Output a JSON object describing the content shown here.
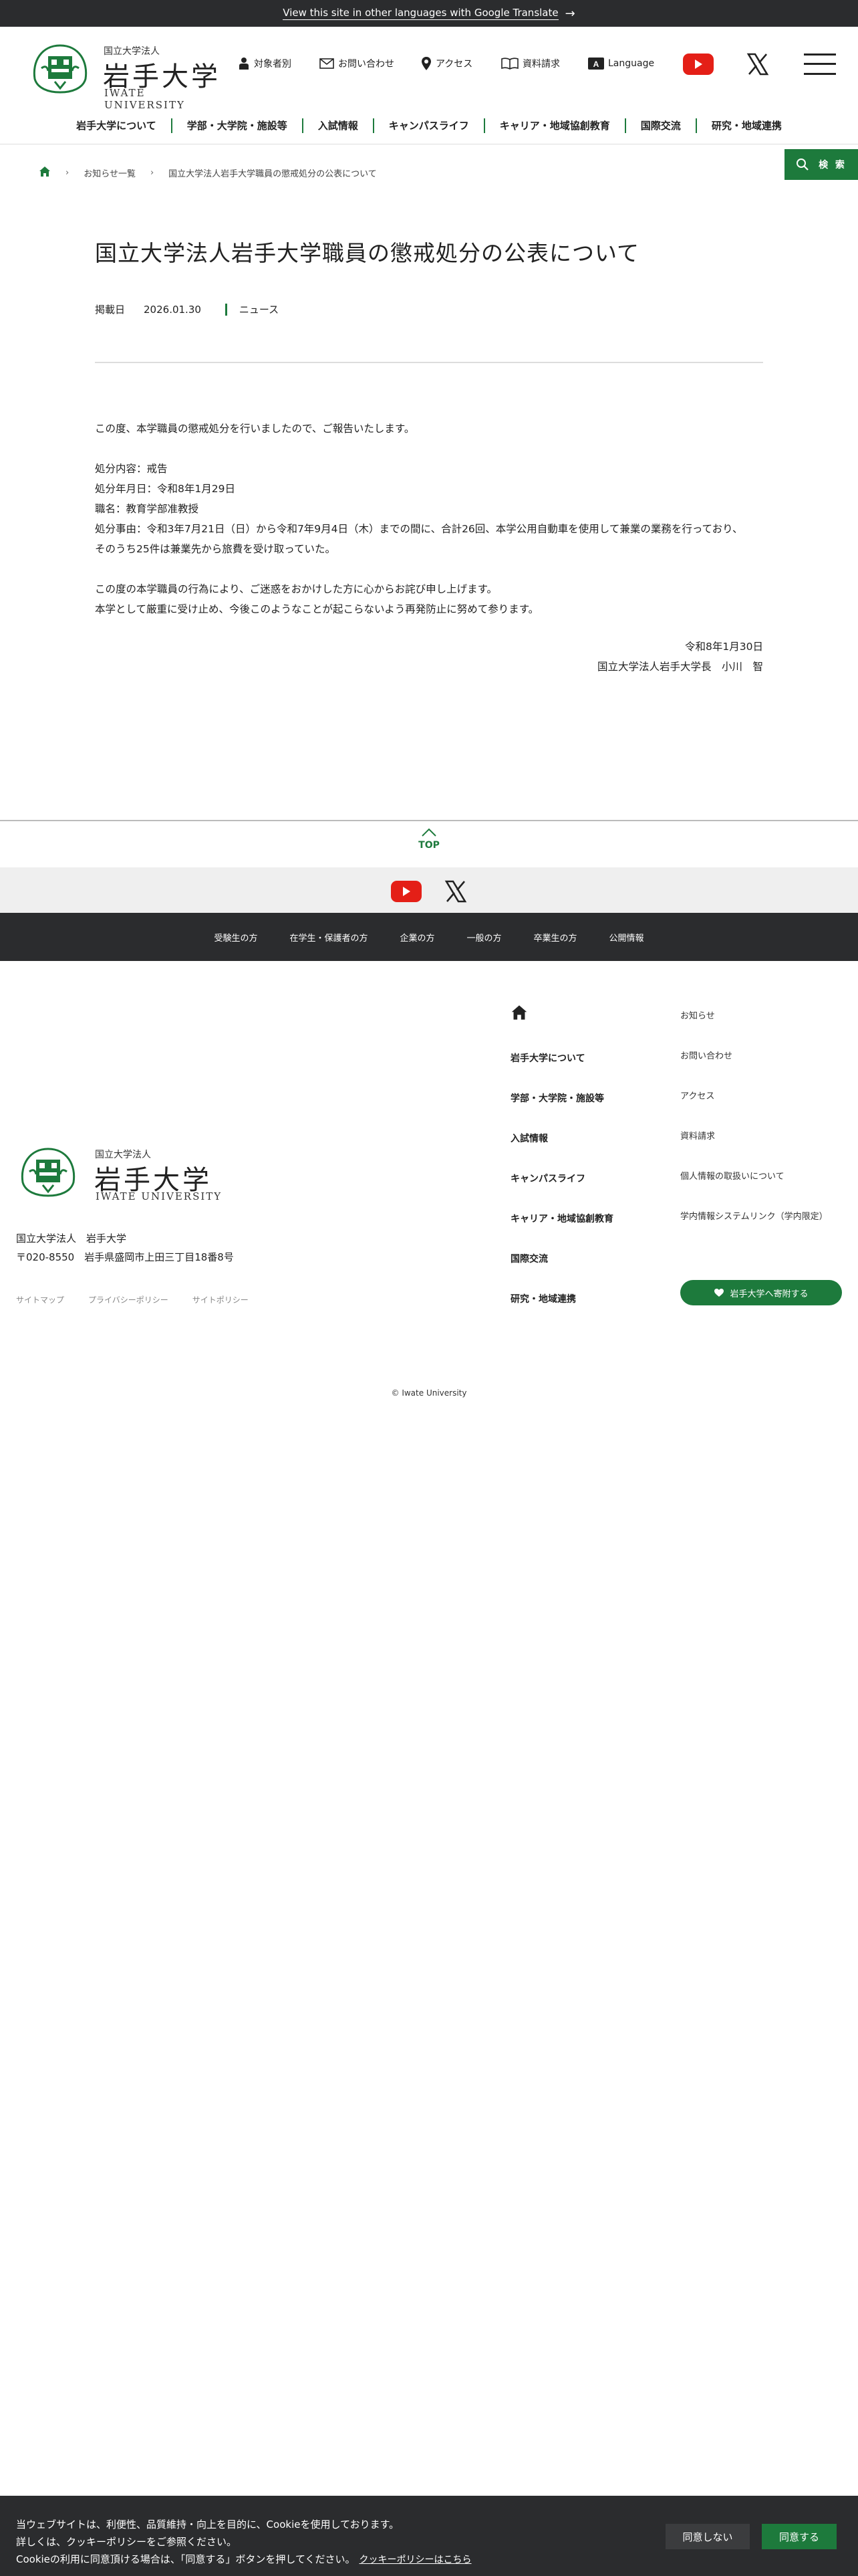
{
  "translate_bar": {
    "text": "View this site in other languages with Google Translate"
  },
  "logo": {
    "corp": "国立大学法人",
    "name": "岩手大学",
    "en": "IWATE UNIVERSITY"
  },
  "utility": {
    "target": "対象者別",
    "contact": "お問い合わせ",
    "access": "アクセス",
    "request": "資料請求",
    "language": "Language"
  },
  "gnav": [
    "岩手大学について",
    "学部・大学院・施設等",
    "入試情報",
    "キャンパスライフ",
    "キャリア・地域協創教育",
    "国際交流",
    "研究・地域連携"
  ],
  "search": {
    "label": "検 索"
  },
  "breadcrumb": {
    "level1": "お知らせ一覧",
    "current": "国立大学法人岩手大学職員の懲戒処分の公表について"
  },
  "article": {
    "title": "国立大学法人岩手大学職員の懲戒処分の公表について",
    "date_label": "掲載日",
    "date": "2026.01.30",
    "category": "ニュース",
    "intro": "この度、本学職員の懲戒処分を行いましたので、ご報告いたします。",
    "detail1": "処分内容：戒告",
    "detail2": "処分年月日：令和8年1月29日",
    "detail3": "職名：教育学部准教授",
    "detail4": "処分事由：令和3年7月21日（日）から令和7年9月4日（木）までの間に、合計26回、本学公用自動車を使用して兼業の業務を行っており、",
    "detail5": "そのうち25件は兼業先から旅費を受け取っていた。",
    "apology1": "この度の本学職員の行為により、ご迷惑をおかけした方に心からお詫び申し上げます。",
    "apology2": "本学として厳重に受け止め、今後このようなことが起こらないよう再発防止に努めて参ります。",
    "sign_date": "令和8年1月30日",
    "sign_name": "国立大学法人岩手大学長　小川　智"
  },
  "pagetop": {
    "label": "TOP"
  },
  "target_nav": [
    "受験生の方",
    "在学生・保護者の方",
    "企業の方",
    "一般の方",
    "卒業生の方",
    "公開情報"
  ],
  "footer": {
    "address_line1": "国立大学法人　岩手大学",
    "address_line2": "〒020-8550　岩手県盛岡市上田三丁目18番8号",
    "links": [
      "サイトマップ",
      "プライバシーポリシー",
      "サイトポリシー"
    ],
    "nav": [
      "岩手大学について",
      "学部・大学院・施設等",
      "入試情報",
      "キャンパスライフ",
      "キャリア・地域協創教育",
      "国際交流",
      "研究・地域連携"
    ],
    "nav2": [
      "お知らせ",
      "お問い合わせ",
      "アクセス",
      "資料請求",
      "個人情報の取扱いについて",
      "学内情報システムリンク（学内限定）"
    ],
    "support": "岩手大学へ寄附する",
    "copyright": "© Iwate University"
  },
  "cookie": {
    "line1": "当ウェブサイトは、利便性、品質維持・向上を目的に、Cookieを使用しております。",
    "line2": "詳しくは、クッキーポリシーをご参照ください。",
    "line3": "Cookieの利用に同意頂ける場合は、「同意する」ボタンを押してください。",
    "policy": "クッキーポリシーはこちら",
    "deny": "同意しない",
    "agree": "同意する"
  },
  "colors": {
    "accent": "#1d7a3c",
    "dark": "#2b2c2e",
    "youtube": "#e41f17"
  }
}
